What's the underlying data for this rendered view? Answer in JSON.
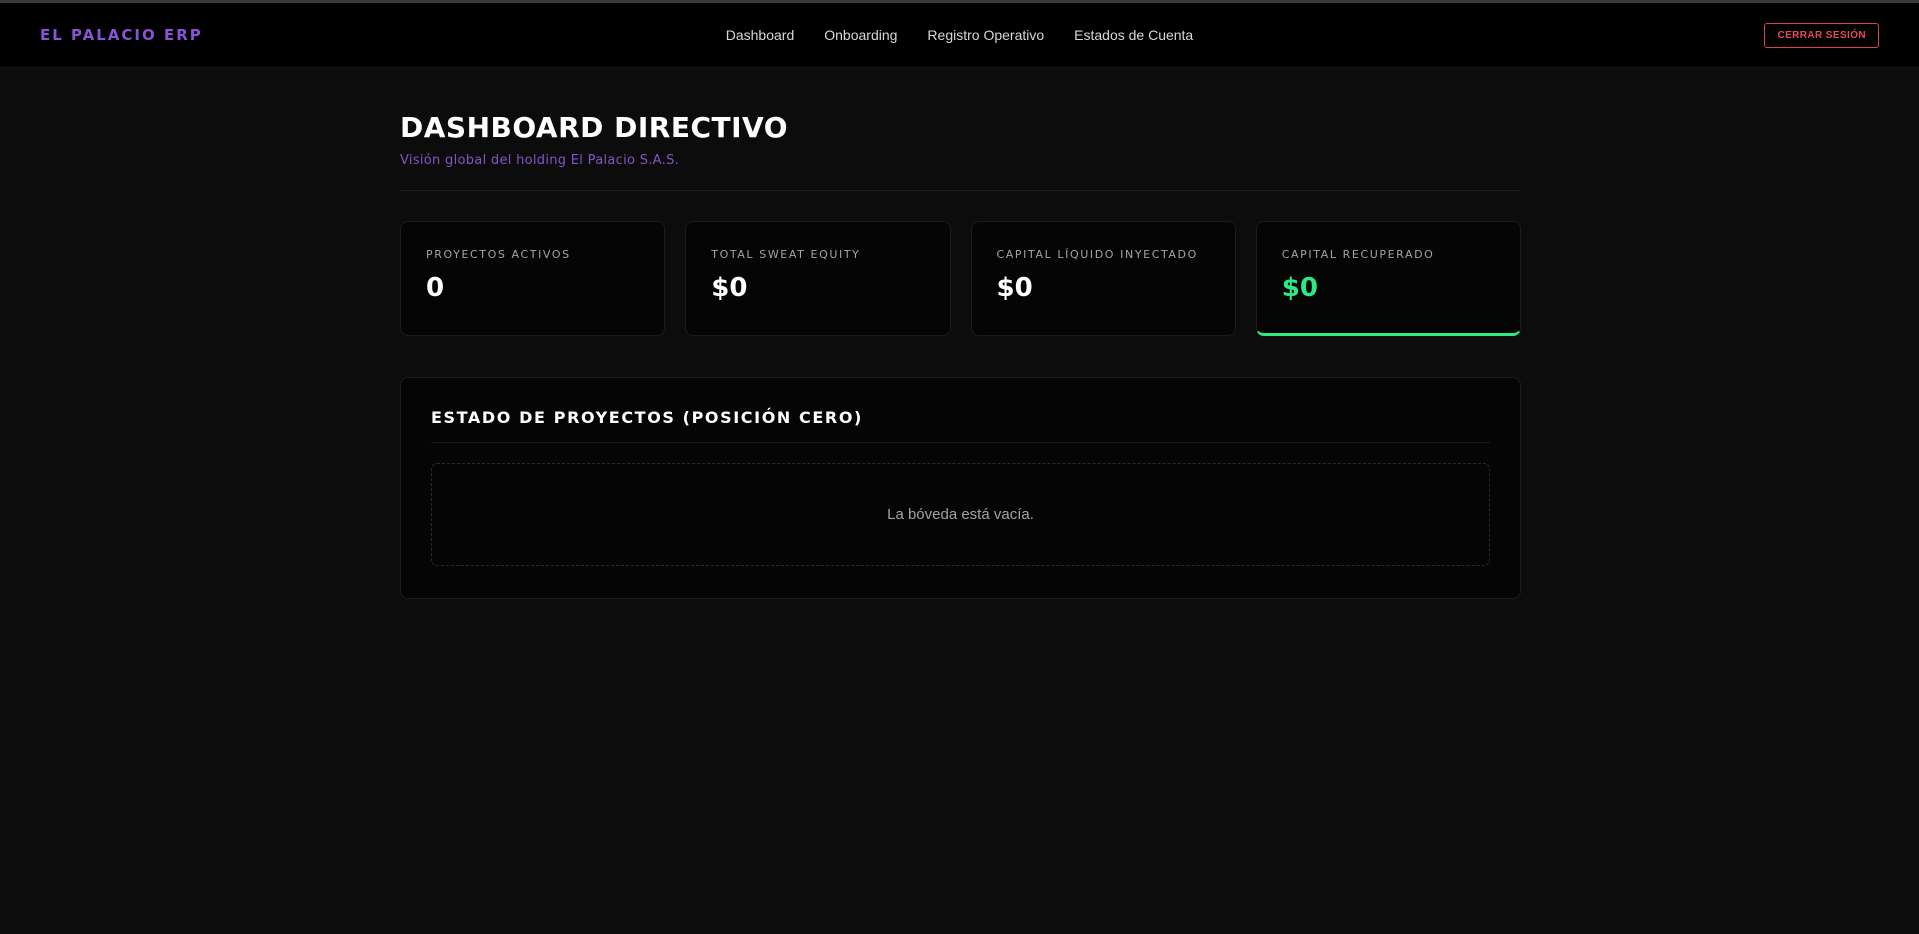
{
  "nav": {
    "brand": "EL PALACIO ERP",
    "links": [
      "Dashboard",
      "Onboarding",
      "Registro Operativo",
      "Estados de Cuenta"
    ],
    "logout_label": "CERRAR SESIÓN"
  },
  "header": {
    "title": "DASHBOARD DIRECTIVO",
    "subtitle": "Visión global del holding El Palacio S.A.S."
  },
  "stats": [
    {
      "label": "PROYECTOS ACTIVOS",
      "value": "0"
    },
    {
      "label": "TOTAL SWEAT EQUITY",
      "value": "$0"
    },
    {
      "label": "CAPITAL LÍQUIDO INYECTADO",
      "value": "$0"
    },
    {
      "label": "CAPITAL RECUPERADO",
      "value": "$0"
    }
  ],
  "projects": {
    "title": "ESTADO DE PROYECTOS (POSICIÓN CERO)",
    "empty_message": "La bóveda está vacía."
  },
  "colors": {
    "brand": "#8a52d4",
    "accent_green": "#2ee884",
    "danger": "#e24b59",
    "background": "#0c0c0c"
  }
}
